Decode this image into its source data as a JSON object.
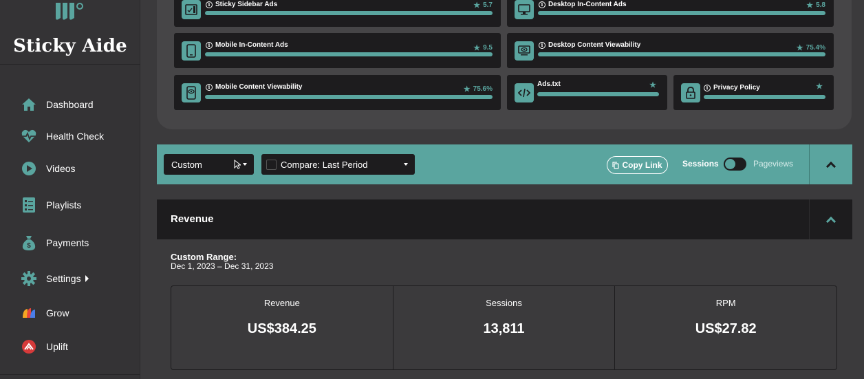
{
  "sidebar": {
    "brand": "Sticky Aide",
    "items": [
      {
        "label": "Dashboard",
        "icon": "home-icon"
      },
      {
        "label": "Health Check",
        "icon": "heart-pulse-icon"
      },
      {
        "label": "Videos",
        "icon": "play-icon"
      },
      {
        "label": "Playlists",
        "icon": "list-icon"
      },
      {
        "label": "Payments",
        "icon": "money-bag-icon"
      },
      {
        "label": "Settings",
        "icon": "gear-icon"
      },
      {
        "label": "Grow",
        "icon": "grow-logo-icon"
      },
      {
        "label": "Uplift",
        "icon": "uplift-logo-icon"
      }
    ]
  },
  "tiles": [
    {
      "name": "Sticky Sidebar Ads",
      "score": "5.7",
      "icon": "sidebar-ad-icon"
    },
    {
      "name": "Desktop In-Content Ads",
      "score": "5.8",
      "icon": "desktop-icon"
    },
    {
      "name": "Mobile In-Content Ads",
      "score": "9.5",
      "icon": "mobile-icon"
    },
    {
      "name": "Desktop Content Viewability",
      "score": "75.4%",
      "icon": "desktop-eye-icon"
    },
    {
      "name": "Mobile Content Viewability",
      "score": "75.6%",
      "icon": "mobile-eye-icon"
    },
    {
      "name": "Ads.txt",
      "score": "",
      "icon": "code-icon"
    },
    {
      "name": "Privacy Policy",
      "score": "",
      "icon": "lock-icon"
    }
  ],
  "filter": {
    "range_select": "Custom",
    "compare_select": "Compare: Last Period",
    "copy_link": "Copy Link",
    "sessions": "Sessions",
    "pageviews": "Pageviews"
  },
  "revenue": {
    "title": "Revenue",
    "range_label": "Custom Range:",
    "range_value": "Dec 1, 2023 – Dec 31, 2023",
    "metrics": [
      {
        "label": "Revenue",
        "value": "US$384.25"
      },
      {
        "label": "Sessions",
        "value": "13,811"
      },
      {
        "label": "RPM",
        "value": "US$27.82"
      }
    ]
  },
  "colors": {
    "accent": "#5aa59f",
    "dark": "#1d1c1e",
    "sidebar": "#343335",
    "background": "#3b3a3c"
  }
}
